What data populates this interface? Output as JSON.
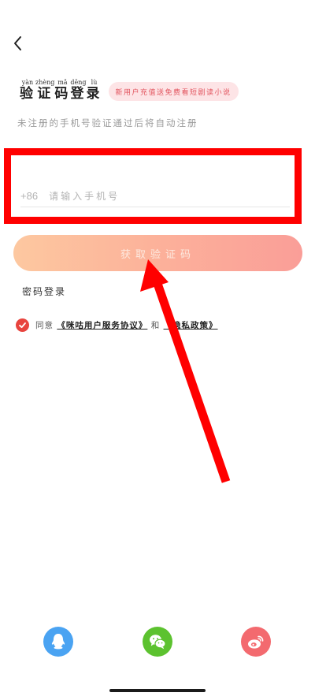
{
  "header": {
    "back_icon": "chevron-left-icon",
    "title_chars": [
      {
        "ch": "验",
        "py": "yàn"
      },
      {
        "ch": "证",
        "py": "zhèng"
      },
      {
        "ch": "码",
        "py": "mǎ"
      },
      {
        "ch": "登",
        "py": "dēng"
      },
      {
        "ch": "录",
        "py": "lù"
      }
    ],
    "promo_badge": "新用户充值送免费看短剧读小说",
    "subtitle": "未注册的手机号验证通过后将自动注册"
  },
  "phone": {
    "country_code": "+86",
    "placeholder": "请输入手机号",
    "value": ""
  },
  "actions": {
    "get_code": "获取验证码",
    "password_login": "密码登录"
  },
  "agreement": {
    "prefix": "同意",
    "user_agreement": "《咪咕用户服务协议》",
    "conjunction": "和",
    "privacy_policy": "《隐私政策》",
    "checked": true
  },
  "social": [
    {
      "name": "qq",
      "icon": "qq-icon",
      "color": "#4aa3f2"
    },
    {
      "name": "wechat",
      "icon": "wechat-icon",
      "color": "#5cc22f"
    },
    {
      "name": "weibo",
      "icon": "weibo-icon",
      "color": "#f36a6f"
    }
  ],
  "colors": {
    "highlight_box": "#ff0000",
    "arrow": "#ff0000",
    "accent": "#e8443e",
    "button_gradient_start": "#fdc8a0",
    "button_gradient_end": "#fa9e98"
  }
}
